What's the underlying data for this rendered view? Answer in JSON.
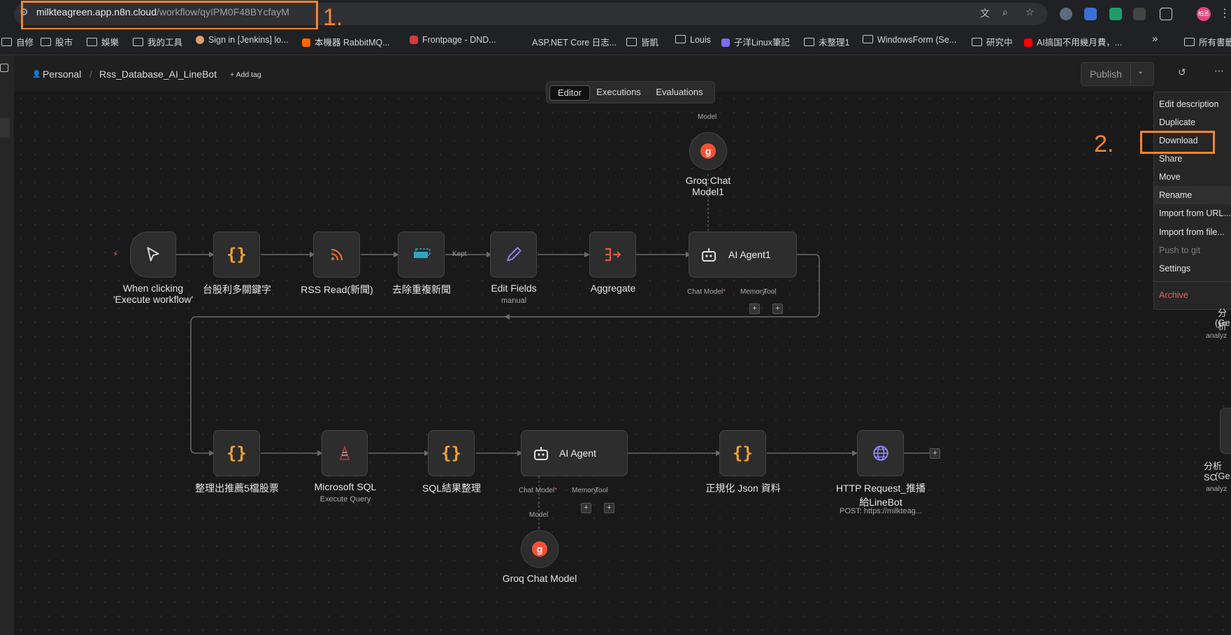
{
  "browser": {
    "url_host": "milkteagreen.app.n8n.cloud",
    "url_path": "/workflow/qyIPM0F48BYcfayM",
    "callout_1": "1.",
    "callout_2": "2.",
    "profile_initials": "柏丞",
    "bookmarks": [
      "自修",
      "股市",
      "娛樂",
      "我的工具",
      "Sign in [Jenkins] lo...",
      "本機器 RabbitMQ...",
      "Frontpage - DND...",
      "ASP.NET Core 日志...",
      "皆凱",
      "Louis",
      "子洋Linux筆記",
      "未整理1",
      "WindowsForm (Se...",
      "研究中",
      "AI搞国不用幾月費，...",
      "所有書籤"
    ],
    "bookmarks_more": "»"
  },
  "header": {
    "project": "Personal",
    "workflow_name": "Rss_Database_AI_LineBot",
    "add_tag": "+ Add tag",
    "publish": "Publish"
  },
  "tabs": [
    "Editor",
    "Executions",
    "Evaluations"
  ],
  "menu": {
    "items": [
      "Edit description",
      "Duplicate",
      "Download",
      "Share",
      "Move",
      "Rename",
      "Import from URL...",
      "Import from file...",
      "Push to git",
      "Settings",
      "Archive"
    ]
  },
  "nodes": {
    "trigger": {
      "title1": "When clicking",
      "title2": "'Execute workflow'"
    },
    "code1": {
      "title": "台股利多關鍵字"
    },
    "rss": {
      "title": "RSS Read(新聞)"
    },
    "dedupe": {
      "title": "去除重複新聞"
    },
    "edit": {
      "title": "Edit Fields",
      "sub": "manual"
    },
    "aggregate": {
      "title": "Aggregate"
    },
    "agent1": {
      "title": "AI Agent1",
      "chat": "Chat Model",
      "memory": "Memory",
      "tool": "Tool"
    },
    "groq1": {
      "title1": "Groq Chat",
      "title2": "Model1",
      "port": "Model"
    },
    "code2": {
      "title": "整理出推薦5檔股票"
    },
    "mssql": {
      "title": "Microsoft SQL",
      "sub": "Execute Query"
    },
    "code3": {
      "title": "SQL結果整理"
    },
    "agent2": {
      "title": "AI Agent",
      "chat": "Chat Model",
      "memory": "Memory",
      "tool": "Tool"
    },
    "code4": {
      "title": "正規化 Json 資料"
    },
    "http": {
      "title1": "HTTP Request_推播",
      "title2": "給LineBot",
      "sub": "POST: https://milkteag..."
    },
    "groq2": {
      "title": "Groq Chat Model",
      "port": "Model"
    },
    "edge_kept": "Kept",
    "partial_right": {
      "a1": "分析",
      "a2": "(Ge",
      "a3": "analyz",
      "b1": "分析SC",
      "b2": "(Ge",
      "b3": "analyz"
    }
  },
  "colors": {
    "accent": "#f5852e",
    "braces": "#f0a236",
    "groq": "#f55036",
    "danger": "#e0665a"
  }
}
